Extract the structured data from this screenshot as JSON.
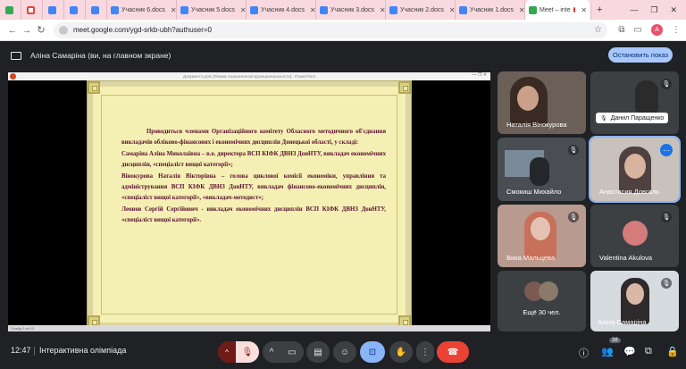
{
  "browser": {
    "tabs": [
      {
        "label": "",
        "favicon": "meet",
        "type": "small"
      },
      {
        "label": "M",
        "favicon": "gmail",
        "type": "small"
      },
      {
        "label": "",
        "favicon": "docs",
        "type": "small"
      },
      {
        "label": "",
        "favicon": "docs",
        "type": "small"
      },
      {
        "label": "",
        "favicon": "docs",
        "type": "small"
      },
      {
        "label": "Учасник 6.docs",
        "favicon": "docs",
        "type": "doc"
      },
      {
        "label": "Учасник 5.docs",
        "favicon": "docs",
        "type": "doc"
      },
      {
        "label": "Учасник 4.docs",
        "favicon": "docs",
        "type": "doc"
      },
      {
        "label": "Учасник 3.docs",
        "favicon": "docs",
        "type": "doc"
      },
      {
        "label": "Учасник 2.docs",
        "favicon": "docs",
        "type": "doc"
      },
      {
        "label": "Учасник 1.docs",
        "favicon": "docs",
        "type": "doc"
      },
      {
        "label": "Meet – inte",
        "favicon": "meet",
        "type": "active"
      }
    ],
    "new_tab": "+",
    "window_controls": [
      "—",
      "❐",
      "✕"
    ],
    "url": "meet.google.com/ygd-srkb-ubh?authuser=0",
    "profile_letter": "A"
  },
  "meet": {
    "presenter_banner": "Аліна Самаріна (ви, на главном экране)",
    "stop_button": "Остановить показ",
    "ppt_title": "Документ1.pptx [Режим ограниченной функциональности] - PowerPoint",
    "ppt_status": "Слайд 3 из 13",
    "slide": {
      "paragraphs": [
        "Проводиться членами Організаційного комітету Обласного методичного об'єднання викладачів обліково-фінансових і економічних дисциплін Донецької області, у складі:",
        "Самаріна Аліна Миколаївна – в.о. директора ВСП КІФК ДВНЗ ДонНТУ, викладач економічних дисциплін, «спеціаліст вищої категорії»;",
        "Вінокурова Наталія Вікторівна – голова циклової комісії економіки, управління та адміністрування ВСП КІФК ДВНЗ ДонНТУ, викладач фінансово-економічних дисциплін, «спеціаліст вищої категорії», «викладач-методист»;",
        "Леонов Сергій Сергійович - викладач економічних дисциплін ВСП КІФК ДВНЗ ДонНТУ, «спеціаліст вищої категорії»."
      ]
    },
    "participants": [
      {
        "name": "Наталія Вінокурова"
      },
      {
        "name": "Данил Паращенко"
      },
      {
        "name": "Смокиш Михайло"
      },
      {
        "name": "Анастасия Довгаль"
      },
      {
        "name": "Вика Мальцева"
      },
      {
        "name": "Valentina Akulova"
      },
      {
        "name": "Ещё 30 чел."
      },
      {
        "name": "Аліна Самаріна"
      }
    ],
    "bottom": {
      "time": "12:47",
      "meeting_name": "Інтерактивна олімпіада",
      "people_count": "38"
    }
  },
  "colors": {
    "meet_bg": "#202124",
    "slide_bg": "#f4f0b4",
    "slide_text": "#5b0f2f",
    "stop_button": "#a8c7fa",
    "end_call": "#ea4335"
  }
}
